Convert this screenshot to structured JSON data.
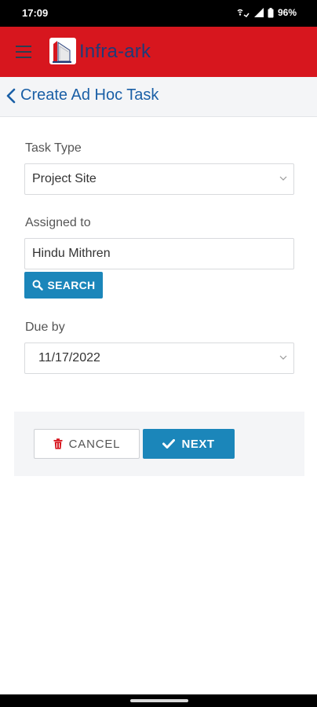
{
  "status_bar": {
    "time": "17:09",
    "battery": "96%",
    "icons": [
      "wifi-call-icon",
      "signal-icon",
      "battery-icon"
    ]
  },
  "app_bar": {
    "brand": "Infra-ark",
    "menu_icon": "hamburger-icon",
    "logo": "infra-ark-logo",
    "color": "#d7161e"
  },
  "header": {
    "title": "Create Ad Hoc Task",
    "back_icon": "chevron-left-icon"
  },
  "form": {
    "task_type": {
      "label": "Task Type",
      "value": "Project Site"
    },
    "assigned_to": {
      "label": "Assigned to",
      "value": "Hindu Mithren"
    },
    "search_button": {
      "label": "SEARCH",
      "icon": "search-icon"
    },
    "due_by": {
      "label": "Due by",
      "value": "11/17/2022"
    }
  },
  "actions": {
    "cancel": {
      "label": "CANCEL",
      "icon": "trash-icon"
    },
    "next": {
      "label": "NEXT",
      "icon": "check-icon"
    }
  },
  "colors": {
    "accent": "#1b86ba",
    "title": "#1a5fa6",
    "danger": "#d7161e"
  }
}
